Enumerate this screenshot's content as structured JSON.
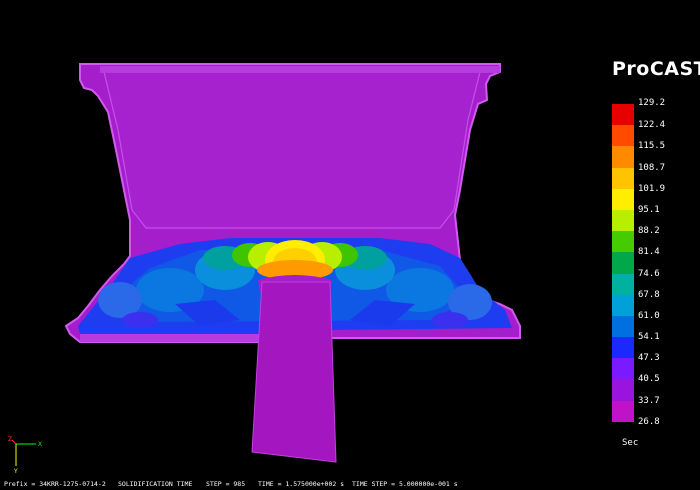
{
  "app": {
    "brand": "ProCAST"
  },
  "legend": {
    "max_label": "129.2",
    "entries": [
      {
        "label": "122.4",
        "color": "#e60000"
      },
      {
        "label": "115.5",
        "color": "#ff4a00"
      },
      {
        "label": "108.7",
        "color": "#ff8a00"
      },
      {
        "label": "101.9",
        "color": "#ffc400"
      },
      {
        "label": "95.1",
        "color": "#ffee00"
      },
      {
        "label": "88.2",
        "color": "#b8ee00"
      },
      {
        "label": "81.4",
        "color": "#44cc00"
      },
      {
        "label": "74.6",
        "color": "#00a84a"
      },
      {
        "label": "67.8",
        "color": "#00b0a0"
      },
      {
        "label": "61.0",
        "color": "#00a0d8"
      },
      {
        "label": "54.1",
        "color": "#0070e0"
      },
      {
        "label": "47.3",
        "color": "#1a2aff"
      },
      {
        "label": "40.5",
        "color": "#7a1aff"
      },
      {
        "label": "33.7",
        "color": "#9a14e0"
      },
      {
        "label": "26.8",
        "color": "#c012c8"
      }
    ],
    "unit": "Sec"
  },
  "status": {
    "prefix": "Prefix = 34KRR-1275-0714-2",
    "quantity": "SOLIDIFICATION TIME",
    "step": "STEP = 985",
    "time": "TIME = 1.575000e+002 s",
    "time_step": "TIME STEP = 5.000000e-001 s"
  },
  "axes": {
    "x_label": "X",
    "y_label": "Y",
    "z_label": "Z"
  },
  "colors": {
    "wheel_body": "#a41ecc",
    "wheel_edge": "#d35af0",
    "background": "#000000"
  }
}
